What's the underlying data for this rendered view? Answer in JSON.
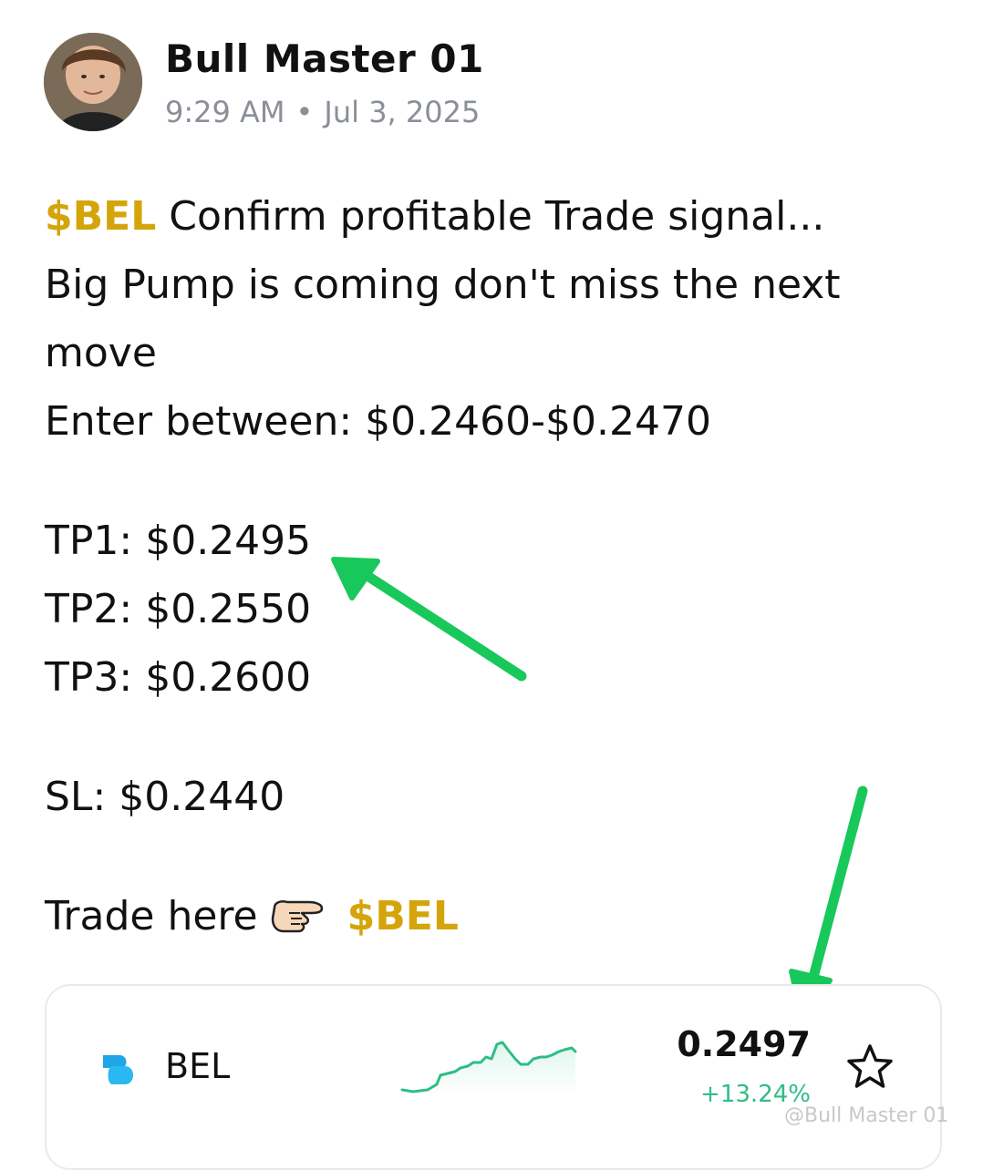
{
  "post": {
    "author": "Bull Master 01",
    "time": "9:29 AM",
    "date": "Jul 3, 2025",
    "cashtag": "$BEL",
    "headline": " Confirm profitable Trade signal...",
    "line2": "Big Pump is coming don't miss the next",
    "line3": "move",
    "entry": "Enter between: $0.2460-$0.2470",
    "tp1": "TP1: $0.2495",
    "tp2": "TP2: $0.2550",
    "tp3": "TP3: $0.2600",
    "sl": "SL: $0.2440",
    "trade_here": "Trade here",
    "trade_cashtag": "$BEL"
  },
  "ticker_card": {
    "symbol": "BEL",
    "price": "0.2497",
    "change": "+13.24%",
    "change_color": "#2ebd85",
    "logo_color": "#1ea7e4",
    "icon": "star-icon"
  },
  "colors": {
    "cashtag": "#d4a50b",
    "annotation_arrow": "#19c85a"
  },
  "watermark": "@Bull Master 01"
}
